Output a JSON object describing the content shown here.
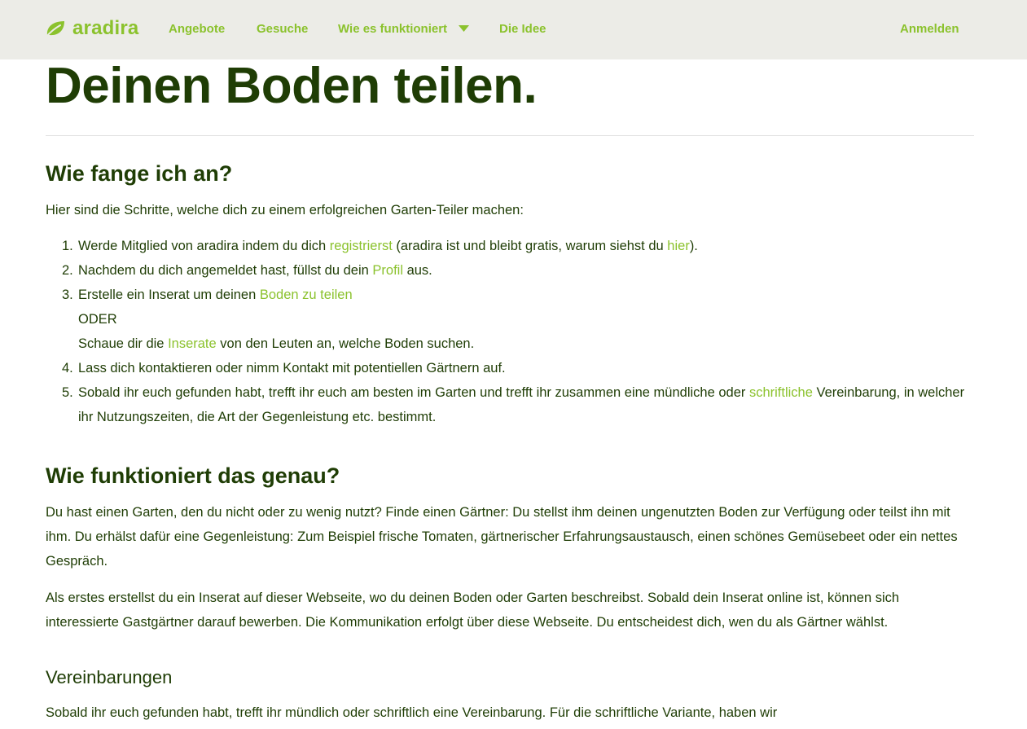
{
  "brand": {
    "name": "aradira",
    "logo_icon": "leaf-icon",
    "color": "#8bc22d"
  },
  "nav": {
    "offers": "Angebote",
    "requests": "Gesuche",
    "how_it_works": "Wie es funktioniert",
    "idea": "Die Idee",
    "login": "Anmelden"
  },
  "page": {
    "title": "Deinen Boden teilen.",
    "section1": {
      "heading": "Wie fange ich an?",
      "intro": "Hier sind die Schritte, welche dich zu einem erfolgreichen Garten-Teiler machen:",
      "steps": [
        {
          "num": "1.",
          "before": "Werde Mitglied von aradira indem du dich ",
          "link1": "registrierst",
          "middle": " (aradira ist und bleibt gratis, warum siehst du ",
          "link2": "hier",
          "after": ")."
        },
        {
          "num": "2.",
          "before": "Nachdem du dich angemeldet hast, füllst du dein ",
          "link": "Profil",
          "after": " aus."
        },
        {
          "num": "3.",
          "before": "Erstelle ein Inserat um deinen ",
          "link": "Boden zu teilen",
          "or": "ODER",
          "before2": "Schaue dir die ",
          "link2": "Inserate",
          "after2": " von den Leuten an, welche Boden suchen."
        },
        {
          "num": "4.",
          "text": "Lass dich kontaktieren oder nimm Kontakt mit potentiellen Gärtnern auf."
        },
        {
          "num": "5.",
          "before": "Sobald ihr euch gefunden habt, trefft ihr euch am besten im Garten und trefft ihr zusammen eine mündliche oder ",
          "link": "schriftliche",
          "after": " Vereinbarung, in welcher ihr Nutzungszeiten, die Art der Gegenleistung etc. bestimmt."
        }
      ]
    },
    "section2": {
      "heading": "Wie funktioniert das genau?",
      "p1": "Du hast einen Garten, den du nicht oder zu wenig nutzt? Finde einen Gärtner: Du stellst ihm deinen ungenutzten Boden zur Verfügung oder teilst ihn mit ihm. Du erhälst dafür eine Gegenleistung: Zum Beispiel frische Tomaten, gärtnerischer Erfahrungsaustausch, einen schönes Gemüsebeet oder ein nettes Gespräch.",
      "p2": "Als erstes erstellst du ein Inserat auf dieser Webseite, wo du deinen Boden oder Garten beschreibst. Sobald dein Inserat online ist, können sich interessierte Gastgärtner darauf bewerben. Die Kommunikation erfolgt über diese Webseite. Du entscheidest dich, wen du als Gärtner wählst."
    },
    "section3": {
      "heading": "Vereinbarungen",
      "p1": "Sobald ihr euch gefunden habt, trefft ihr mündlich oder schriftlich eine Vereinbarung. Für die schriftliche Variante, haben wir"
    }
  },
  "colors": {
    "accent": "#8bc22d",
    "text": "#1f3d05",
    "topbar_bg": "#ecece7"
  }
}
